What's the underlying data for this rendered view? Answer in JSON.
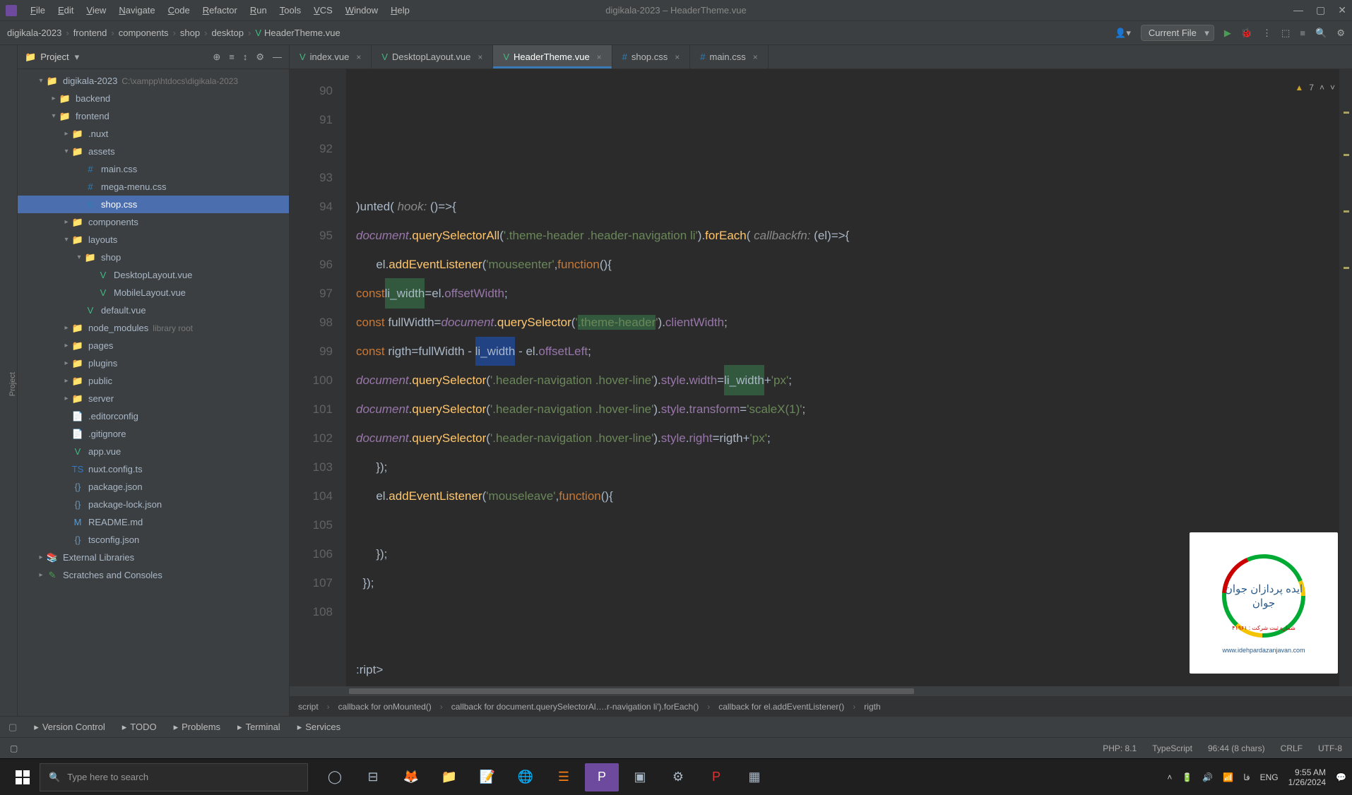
{
  "titlebar": {
    "menu": [
      "File",
      "Edit",
      "View",
      "Navigate",
      "Code",
      "Refactor",
      "Run",
      "Tools",
      "VCS",
      "Window",
      "Help"
    ],
    "title": "digikala-2023 – HeaderTheme.vue"
  },
  "breadcrumb": [
    "digikala-2023",
    "frontend",
    "components",
    "shop",
    "desktop",
    "HeaderTheme.vue"
  ],
  "run_config": "Current File",
  "project_panel": {
    "title": "Project"
  },
  "tree": {
    "root": {
      "name": "digikala-2023",
      "path": "C:\\xampp\\htdocs\\digikala-2023"
    },
    "items": [
      {
        "indent": 1,
        "chev": "▾",
        "icon": "folder",
        "name": "digikala-2023",
        "muted": "C:\\xampp\\htdocs\\digikala-2023"
      },
      {
        "indent": 2,
        "chev": "▸",
        "icon": "folder",
        "name": "backend"
      },
      {
        "indent": 2,
        "chev": "▾",
        "icon": "folder",
        "name": "frontend"
      },
      {
        "indent": 3,
        "chev": "▸",
        "icon": "folder",
        "name": ".nuxt"
      },
      {
        "indent": 3,
        "chev": "▾",
        "icon": "folder",
        "name": "assets"
      },
      {
        "indent": 4,
        "chev": "",
        "icon": "css",
        "name": "main.css"
      },
      {
        "indent": 4,
        "chev": "",
        "icon": "css",
        "name": "mega-menu.css"
      },
      {
        "indent": 4,
        "chev": "",
        "icon": "css",
        "name": "shop.css",
        "selected": true
      },
      {
        "indent": 3,
        "chev": "▸",
        "icon": "folder",
        "name": "components"
      },
      {
        "indent": 3,
        "chev": "▾",
        "icon": "folder",
        "name": "layouts"
      },
      {
        "indent": 4,
        "chev": "▾",
        "icon": "folder",
        "name": "shop"
      },
      {
        "indent": 5,
        "chev": "",
        "icon": "vue",
        "name": "DesktopLayout.vue"
      },
      {
        "indent": 5,
        "chev": "",
        "icon": "vue",
        "name": "MobileLayout.vue"
      },
      {
        "indent": 4,
        "chev": "",
        "icon": "vue",
        "name": "default.vue"
      },
      {
        "indent": 3,
        "chev": "▸",
        "icon": "folder",
        "name": "node_modules",
        "muted": "library root"
      },
      {
        "indent": 3,
        "chev": "▸",
        "icon": "folder",
        "name": "pages"
      },
      {
        "indent": 3,
        "chev": "▸",
        "icon": "folder",
        "name": "plugins"
      },
      {
        "indent": 3,
        "chev": "▸",
        "icon": "folder",
        "name": "public"
      },
      {
        "indent": 3,
        "chev": "▸",
        "icon": "folder",
        "name": "server"
      },
      {
        "indent": 3,
        "chev": "",
        "icon": "file",
        "name": ".editorconfig"
      },
      {
        "indent": 3,
        "chev": "",
        "icon": "file",
        "name": ".gitignore"
      },
      {
        "indent": 3,
        "chev": "",
        "icon": "vue",
        "name": "app.vue"
      },
      {
        "indent": 3,
        "chev": "",
        "icon": "ts",
        "name": "nuxt.config.ts"
      },
      {
        "indent": 3,
        "chev": "",
        "icon": "json",
        "name": "package.json"
      },
      {
        "indent": 3,
        "chev": "",
        "icon": "json",
        "name": "package-lock.json"
      },
      {
        "indent": 3,
        "chev": "",
        "icon": "md",
        "name": "README.md"
      },
      {
        "indent": 3,
        "chev": "",
        "icon": "json",
        "name": "tsconfig.json"
      },
      {
        "indent": 1,
        "chev": "▸",
        "icon": "lib",
        "name": "External Libraries"
      },
      {
        "indent": 1,
        "chev": "▸",
        "icon": "scratch",
        "name": "Scratches and Consoles"
      }
    ]
  },
  "tabs": [
    {
      "icon": "vue",
      "label": "index.vue"
    },
    {
      "icon": "vue",
      "label": "DesktopLayout.vue"
    },
    {
      "icon": "vue",
      "label": "HeaderTheme.vue",
      "active": true
    },
    {
      "icon": "css",
      "label": "shop.css"
    },
    {
      "icon": "css",
      "label": "main.css"
    }
  ],
  "gutter_start": 90,
  "code_lines": [
    {
      "html": ""
    },
    {
      "html": "<span>)unted( </span><span class='par'>hook:</span><span> ()=&gt;{</span>"
    },
    {
      "html": "  <span class='ital'>document</span>.<span class='fn'>querySelectorAll</span>(<span class='str'>'.theme-header .header-navigation li'</span>).<span class='fn'>forEach</span>( <span class='par'>callbackfn:</span> (el)=&gt;{"
    },
    {
      "html": "      el.<span class='fn'>addEventListener</span>(<span class='str'>'mouseenter'</span>,<span class='kw'>function</span>(){"
    },
    {
      "html": "          <span class='kw'>const</span> <span class='usage-high'>li_width</span>=el.<span class='prop'>offsetWidth</span>;"
    },
    {
      "html": "          <span class='kw'>const</span> fullWidth=<span class='ital'>document</span>.<span class='fn'>querySelector</span>(<span class='str'>'<span class='usage-high'>.theme-header</span>'</span>).<span class='prop'>clientWidth</span>;"
    },
    {
      "html": "          <span class='kw'>const</span> rigth=fullWidth - <span class='sel-high'>li_width</span> - el.<span class='prop'>offsetLeft</span>;"
    },
    {
      "html": "          <span class='ital'>document</span>.<span class='fn'>querySelector</span>(<span class='str'>'.header-navigation .hover-line'</span>).<span class='prop'>style</span>.<span class='prop'>width</span>=<span class='usage-high'>li_width</span>+<span class='str'>'px'</span>;"
    },
    {
      "html": "          <span class='ital'>document</span>.<span class='fn'>querySelector</span>(<span class='str'>'.header-navigation .hover-line'</span>).<span class='prop'>style</span>.<span class='prop'>transform</span>=<span class='str'>'scaleX(1)'</span>;"
    },
    {
      "html": "           <span class='ital'>document</span>.<span class='fn'>querySelector</span>(<span class='str'>'.header-navigation .hover-line'</span>).<span class='prop'>style</span>.<span class='prop'>right</span>=rigth+<span class='str'>'px'</span>;"
    },
    {
      "html": "      });"
    },
    {
      "html": "      el.<span class='fn'>addEventListener</span>(<span class='str'>'mouseleave'</span>,<span class='kw'>function</span>(){"
    },
    {
      "html": ""
    },
    {
      "html": "      });"
    },
    {
      "html": "  });"
    },
    {
      "html": ""
    },
    {
      "html": ""
    },
    {
      "html": ":ript&gt;"
    },
    {
      "html": ""
    }
  ],
  "inspection": {
    "warnings": "7"
  },
  "crumb_bottom": [
    "script",
    "callback for onMounted()",
    "callback for document.querySelectorAl….r-navigation li').forEach()",
    "callback for el.addEventListener()",
    "rigth"
  ],
  "bottom_tools": [
    "Version Control",
    "TODO",
    "Problems",
    "Terminal",
    "Services"
  ],
  "status": {
    "php": "PHP: 8.1",
    "lang": "TypeScript",
    "pos": "96:44 (8 chars)",
    "le": "CRLF",
    "enc": "UTF-8"
  },
  "taskbar": {
    "search_placeholder": "Type here to search",
    "time": "9:55 AM",
    "date": "1/26/2024",
    "lang": "ENG"
  },
  "watermark": {
    "brand": "ایده پردازان جوان",
    "sub": "شماره ثبت شرکت : ۴۱۹۶۱",
    "url": "www.idehpardazanjavan.com"
  }
}
